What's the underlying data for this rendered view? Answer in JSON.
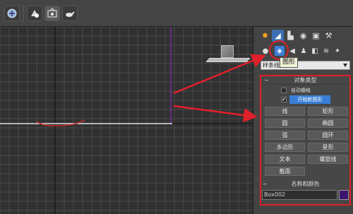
{
  "toolbar": {
    "icons": [
      "render-setup-icon",
      "render-frame-icon",
      "rendered-frame-window-icon",
      "render-production-icon"
    ]
  },
  "viewport": {
    "grid_color": "#4a4a4a",
    "axis_color": "#1a1a1a",
    "highlight_axis_color": "#7a2aa0",
    "shape_color": "#cc2a2a"
  },
  "command_panel": {
    "tabs": [
      "create-tab",
      "modify-tab",
      "hierarchy-tab",
      "motion-tab",
      "display-tab",
      "utilities-tab"
    ],
    "sub_categories": [
      "geometry",
      "shapes",
      "lights",
      "cameras",
      "helpers",
      "space-warps",
      "systems"
    ],
    "category_dropdown": "样条线",
    "tooltip": "图形",
    "object_type": {
      "title": "对象类型",
      "auto_grid_label": "自动栅格",
      "start_new_shape_label": "开始新图形",
      "start_new_shape_checked": "✔",
      "buttons": [
        [
          "线",
          "矩形"
        ],
        [
          "圆",
          "椭圆"
        ],
        [
          "弧",
          "圆环"
        ],
        [
          "多边形",
          "星形"
        ],
        [
          "文本",
          "螺旋线"
        ],
        [
          "截面"
        ]
      ]
    },
    "name_and_color": {
      "title": "名称和颜色",
      "name_value": "Box002",
      "color": "#3d1470"
    }
  },
  "accent": "#e0202a"
}
